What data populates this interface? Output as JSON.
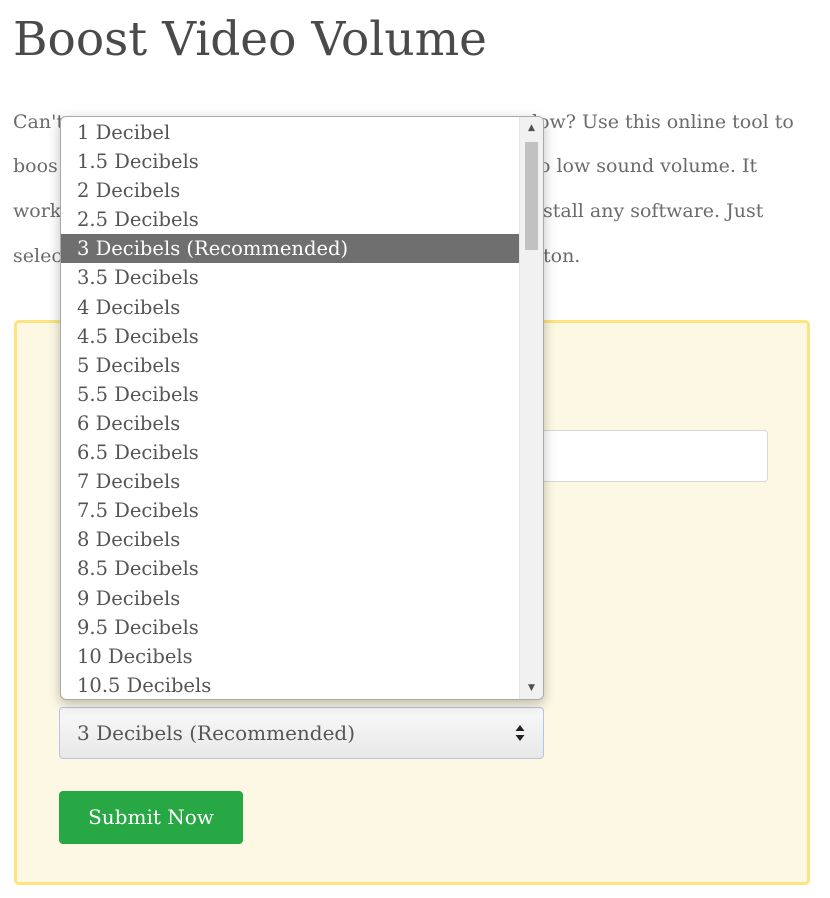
{
  "page": {
    "title": "Boost Video Volume",
    "intro_lines": [
      {
        "left": "Can't",
        "right": "low? Use this online tool to"
      },
      {
        "left": "boos",
        "right": "o low sound volume. It"
      },
      {
        "left": "work",
        "right": "stall any software. Just"
      },
      {
        "left": "selec",
        "right": "ton."
      }
    ]
  },
  "form": {
    "volume_select": {
      "selected": "3 Decibels (Recommended)",
      "options": [
        "1 Decibel",
        "1.5 Decibels",
        "2 Decibels",
        "2.5 Decibels",
        "3 Decibels (Recommended)",
        "3.5 Decibels",
        "4 Decibels",
        "4.5 Decibels",
        "5 Decibels",
        "5.5 Decibels",
        "6 Decibels",
        "6.5 Decibels",
        "7 Decibels",
        "7.5 Decibels",
        "8 Decibels",
        "8.5 Decibels",
        "9 Decibels",
        "9.5 Decibels",
        "10 Decibels",
        "10.5 Decibels"
      ],
      "highlighted_index": 4
    },
    "submit_label": "Submit Now"
  },
  "colors": {
    "form_background": "#fdf8e3",
    "form_border": "#fde47e",
    "submit_button": "#28a745",
    "option_highlight": "#6f6f6f"
  },
  "icons": {
    "select_arrows": "up-down-arrows-icon",
    "scroll_up": "triangle-up-icon",
    "scroll_down": "triangle-down-icon"
  }
}
